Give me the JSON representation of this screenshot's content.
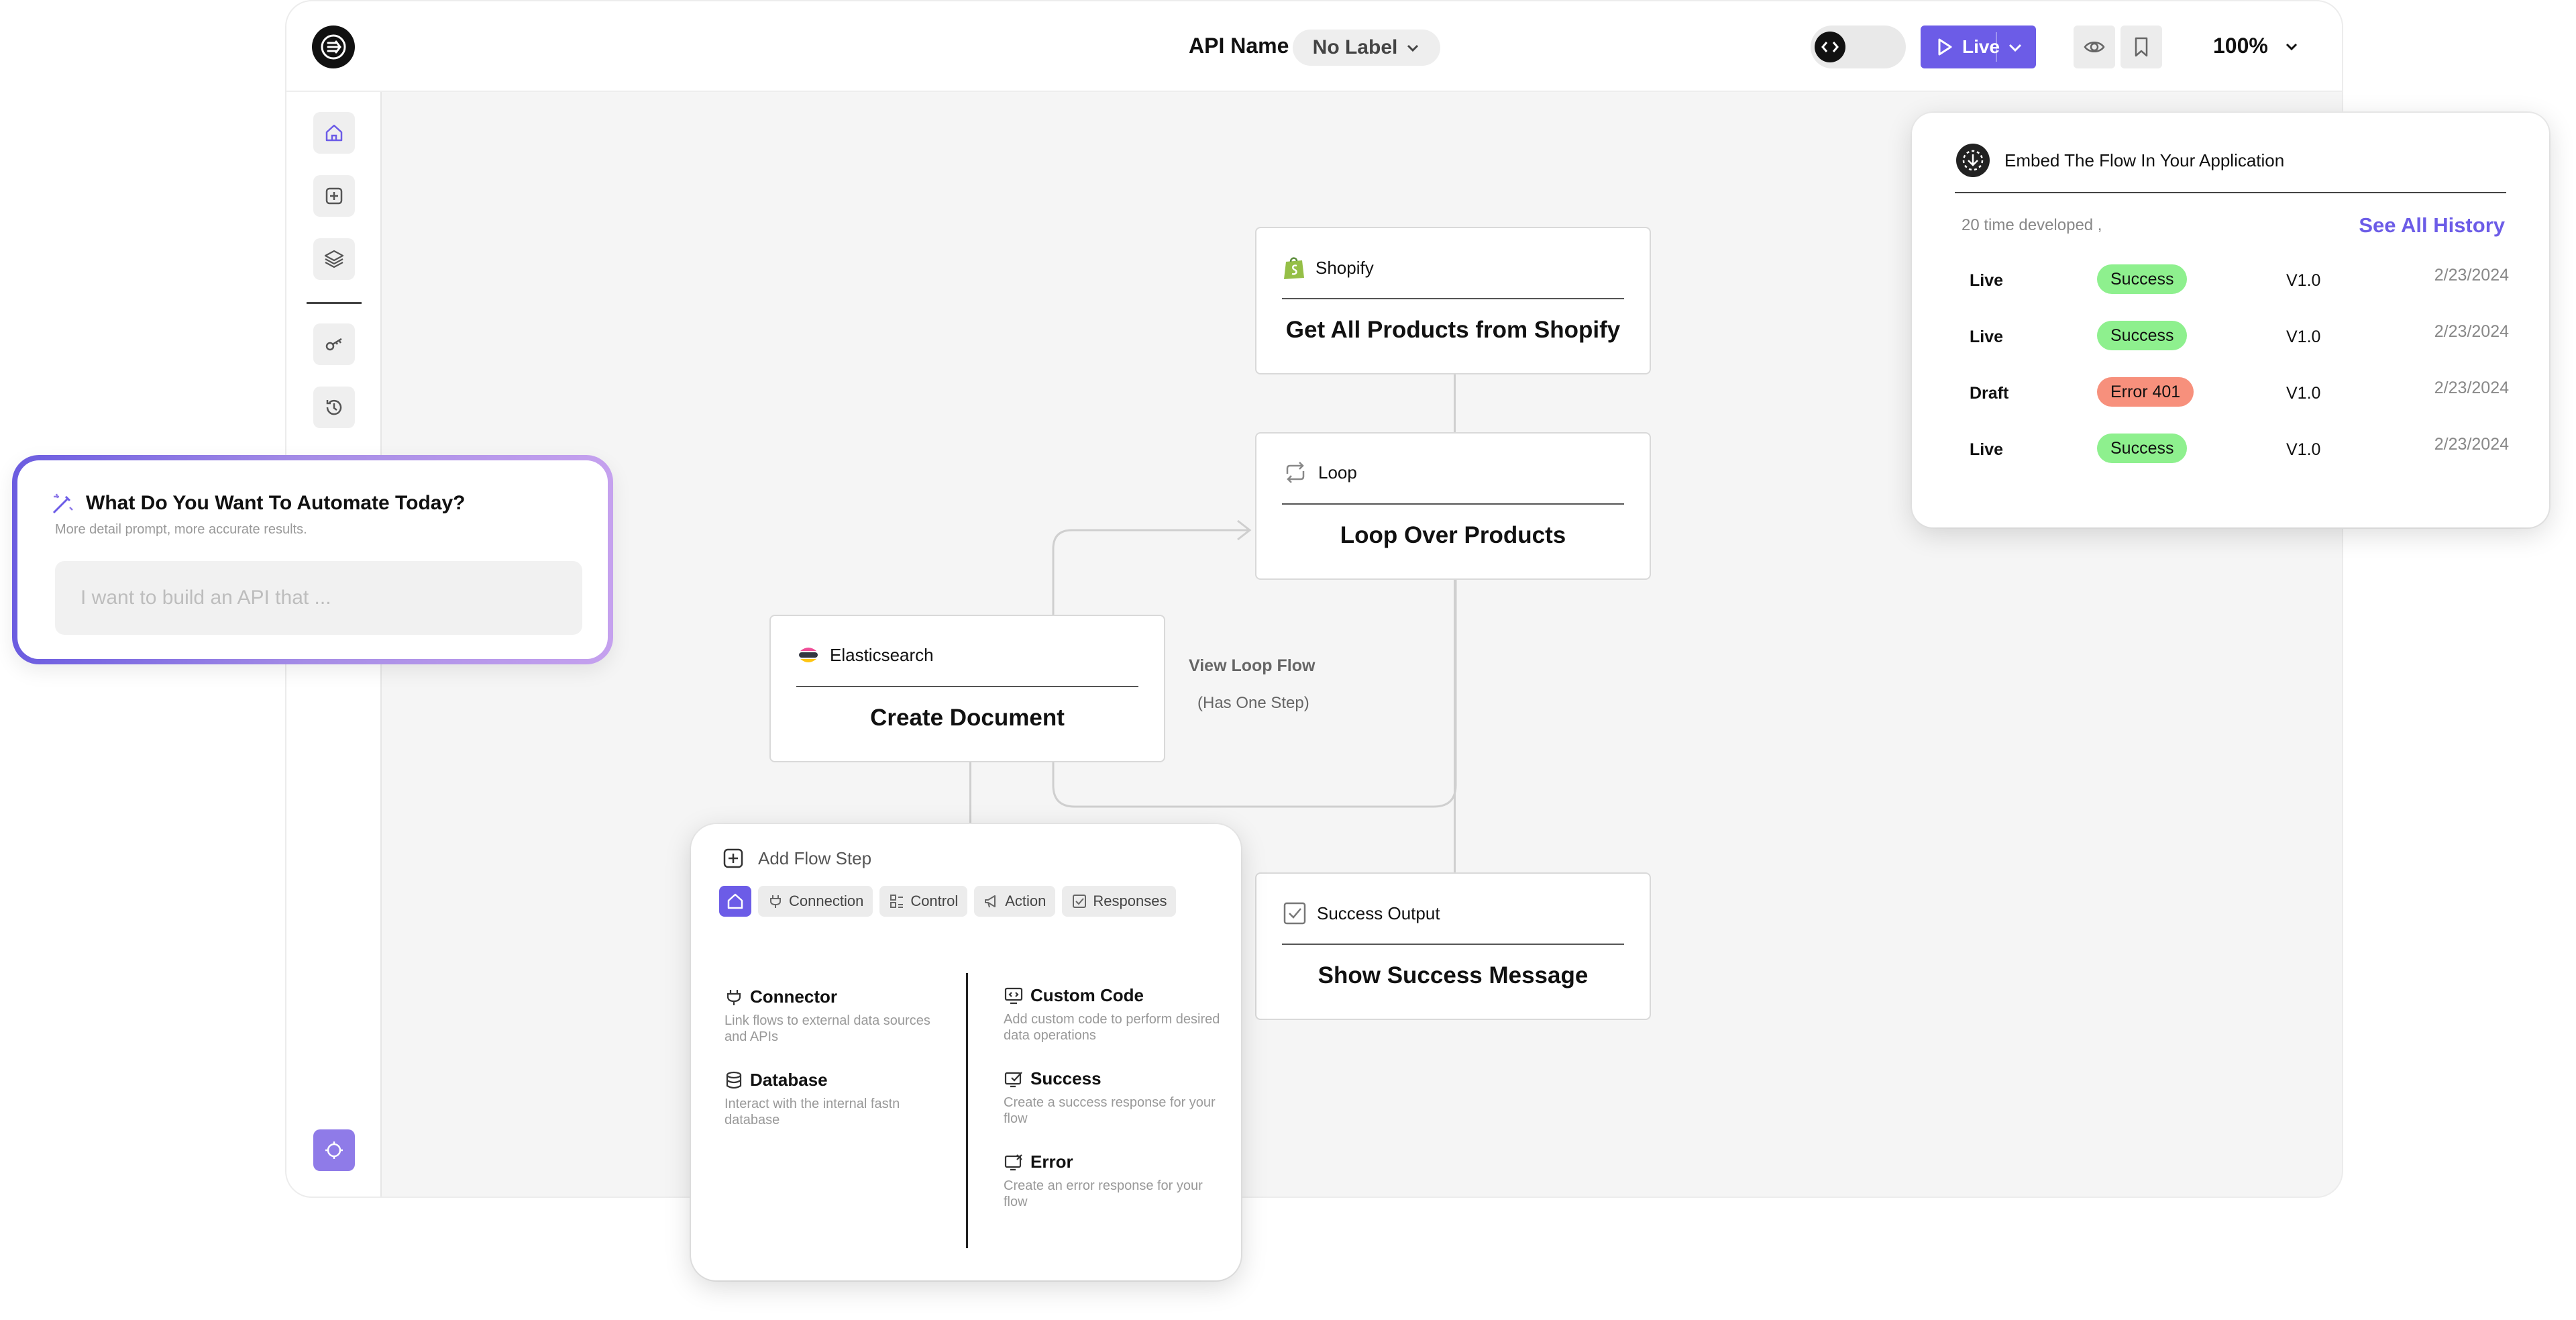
{
  "header": {
    "api_name_label": "API Name",
    "label_selector": "No Label",
    "live_button": "Live",
    "zoom": "100%"
  },
  "flow": {
    "nodes": {
      "shopify": {
        "service": "Shopify",
        "title": "Get All Products from Shopify"
      },
      "loop": {
        "service": "Loop",
        "title": "Loop Over Products"
      },
      "elasticsearch": {
        "service": "Elasticsearch",
        "title": "Create Document"
      },
      "success": {
        "service": "Success Output",
        "title": "Show Success Message"
      }
    },
    "loop_flow_link": "View Loop Flow",
    "loop_flow_note": "(Has One Step)"
  },
  "automate": {
    "title": "What Do You Want To Automate Today?",
    "subtitle": "More detail prompt, more accurate results.",
    "placeholder": "I want to build an API that ..."
  },
  "embed": {
    "title": "Embed The Flow In Your Application",
    "developed_count": "20 time developed ,",
    "see_all": "See All History",
    "history": [
      {
        "status": "Live",
        "result": "Success",
        "version": "V1.0",
        "date": "2/23/2024"
      },
      {
        "status": "Live",
        "result": "Success",
        "version": "V1.0",
        "date": "2/23/2024"
      },
      {
        "status": "Draft",
        "result": "Error 401",
        "version": "V1.0",
        "date": "2/23/2024"
      },
      {
        "status": "Live",
        "result": "Success",
        "version": "V1.0",
        "date": "2/23/2024"
      }
    ],
    "colors": {
      "success_badge": "#8ef08e",
      "error_badge": "#f7907c"
    }
  },
  "add_flow": {
    "title": "Add Flow Step",
    "tabs": [
      "Connection",
      "Control",
      "Action",
      "Responses"
    ],
    "left_options": [
      {
        "name": "Connector",
        "desc": "Link flows to external data sources and APIs"
      },
      {
        "name": "Database",
        "desc": "Interact with the internal fastn database"
      }
    ],
    "right_options": [
      {
        "name": "Custom Code",
        "desc": "Add custom code to perform desired data operations"
      },
      {
        "name": "Success",
        "desc": "Create a success response for your flow"
      },
      {
        "name": "Error",
        "desc": "Create an error response for your flow"
      }
    ]
  },
  "theme": {
    "accent": "#6c5ce7",
    "canvas": "#f5f5f5"
  }
}
